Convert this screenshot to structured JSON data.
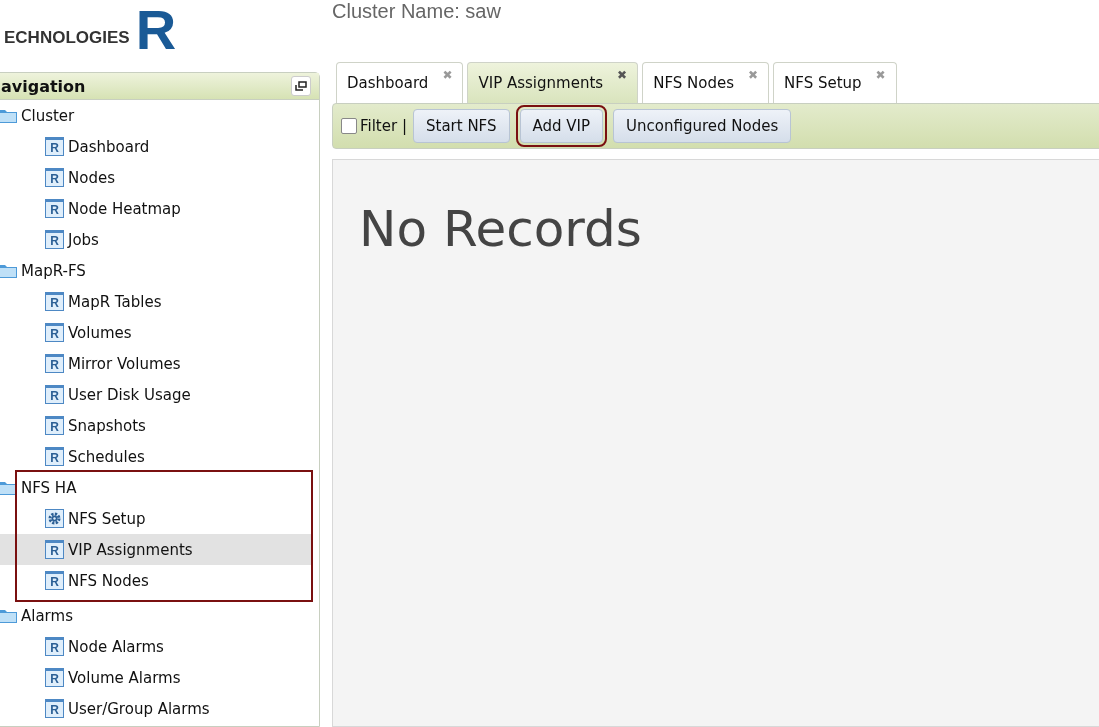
{
  "logo": {
    "mark": "R",
    "tagline": "ECHNOLOGIES"
  },
  "cluster_name": "Cluster Name: saw",
  "navigation": {
    "title": "avigation",
    "groups": [
      {
        "label": "Cluster",
        "highlighted": false,
        "children": [
          {
            "label": "Dashboard",
            "kind": "report",
            "badge": "R",
            "selected": false
          },
          {
            "label": "Nodes",
            "kind": "report",
            "badge": "R",
            "selected": false
          },
          {
            "label": "Node Heatmap",
            "kind": "report",
            "badge": "R",
            "selected": false
          },
          {
            "label": "Jobs",
            "kind": "report",
            "badge": "R",
            "selected": false
          }
        ]
      },
      {
        "label": "MapR-FS",
        "highlighted": false,
        "children": [
          {
            "label": "MapR Tables",
            "kind": "report",
            "badge": "R",
            "selected": false
          },
          {
            "label": "Volumes",
            "kind": "report",
            "badge": "R",
            "selected": false
          },
          {
            "label": "Mirror Volumes",
            "kind": "report",
            "badge": "R",
            "selected": false
          },
          {
            "label": "User Disk Usage",
            "kind": "report",
            "badge": "R",
            "selected": false
          },
          {
            "label": "Snapshots",
            "kind": "report",
            "badge": "R",
            "selected": false
          },
          {
            "label": "Schedules",
            "kind": "report",
            "badge": "R",
            "selected": false
          }
        ]
      },
      {
        "label": "NFS HA",
        "highlighted": true,
        "children": [
          {
            "label": "NFS Setup",
            "kind": "gear",
            "selected": false
          },
          {
            "label": "VIP Assignments",
            "kind": "report",
            "badge": "R",
            "selected": true
          },
          {
            "label": "NFS Nodes",
            "kind": "report",
            "badge": "R",
            "selected": false
          }
        ]
      },
      {
        "label": "Alarms",
        "highlighted": false,
        "children": [
          {
            "label": "Node Alarms",
            "kind": "report",
            "badge": "R",
            "selected": false
          },
          {
            "label": "Volume Alarms",
            "kind": "report",
            "badge": "R",
            "selected": false
          },
          {
            "label": "User/Group Alarms",
            "kind": "report",
            "badge": "R",
            "selected": false
          }
        ]
      }
    ]
  },
  "tabs": [
    {
      "label": "Dashboard",
      "close": "✖",
      "selected": false
    },
    {
      "label": "VIP Assignments",
      "close": "✖",
      "selected": true
    },
    {
      "label": "NFS Nodes",
      "close": "✖",
      "selected": false
    },
    {
      "label": "NFS Setup",
      "close": "✖",
      "selected": false
    }
  ],
  "toolbar": {
    "filter": {
      "label": "Filter |",
      "checked": false
    },
    "buttons": [
      {
        "label": "Start NFS",
        "highlighted": false
      },
      {
        "label": "Add VIP",
        "highlighted": true
      },
      {
        "label": "Unconfigured Nodes",
        "highlighted": false
      }
    ]
  },
  "content": {
    "message": "No Records"
  }
}
